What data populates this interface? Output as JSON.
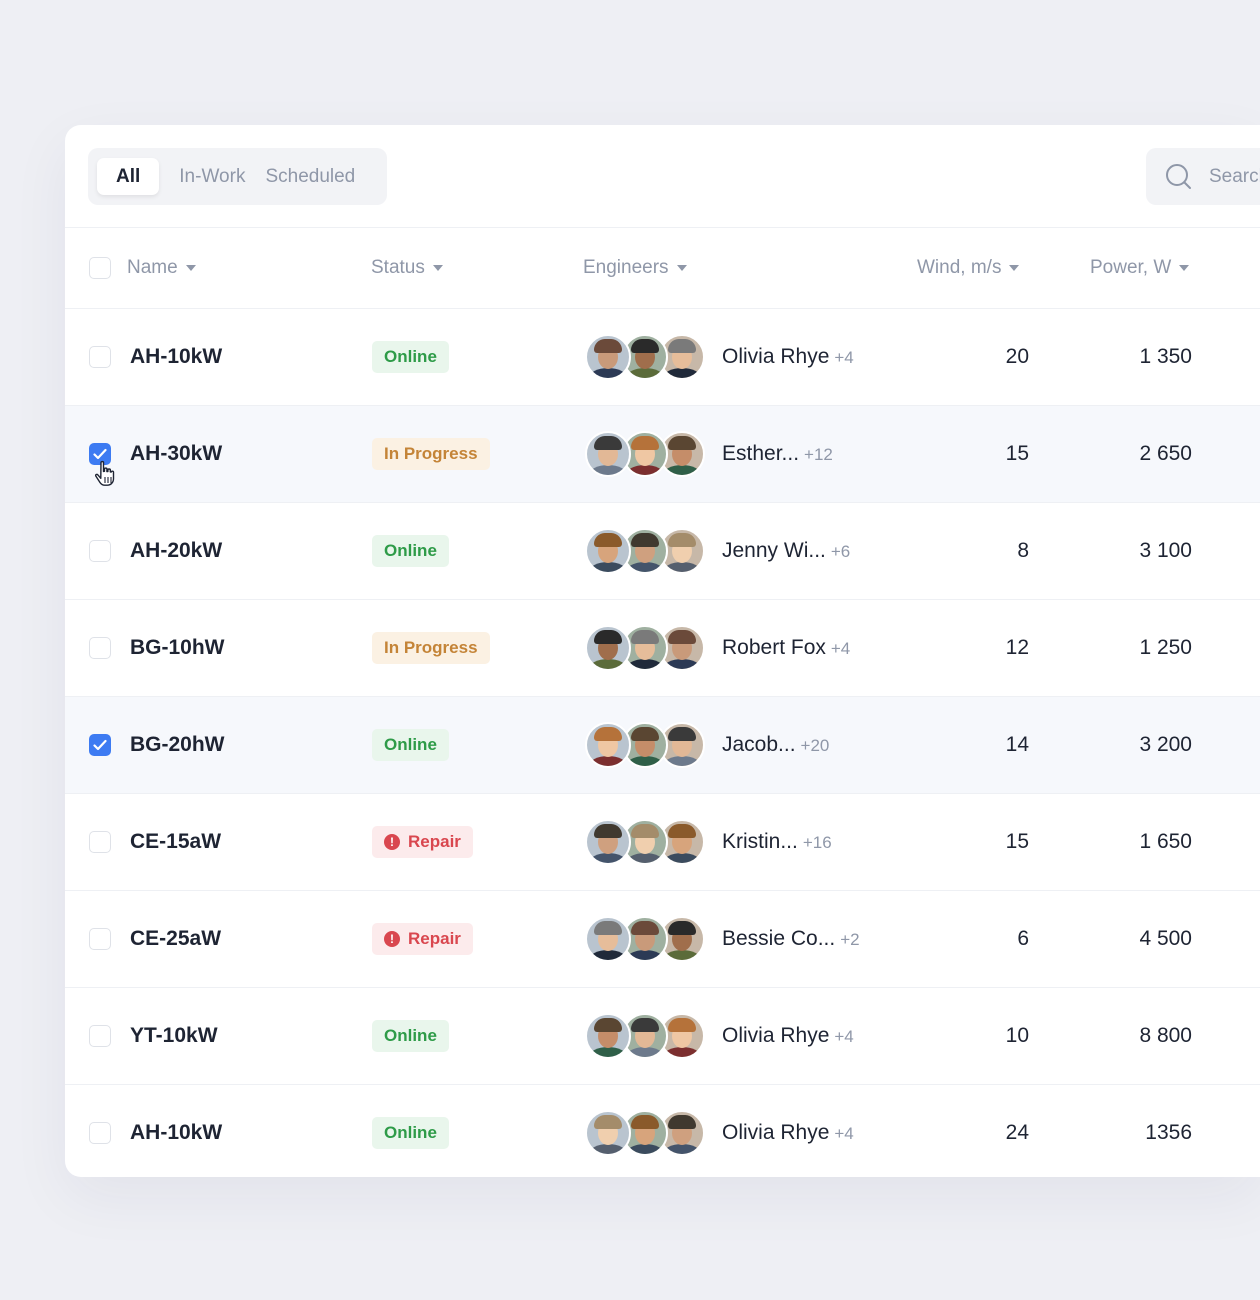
{
  "tabs": [
    {
      "label": "All",
      "active": true
    },
    {
      "label": "In-Work",
      "active": false
    },
    {
      "label": "Scheduled",
      "active": false
    }
  ],
  "search": {
    "placeholder": "Search",
    "icon": "search-icon"
  },
  "columns": {
    "name": "Name",
    "status": "Status",
    "engineers": "Engineers",
    "wind": "Wind, m/s",
    "power": "Power, W"
  },
  "colors": {
    "accent": "#3d7bf2",
    "online": "#2e9b48",
    "in_progress": "#c48437",
    "repair": "#d9474f"
  },
  "rows": [
    {
      "name": "AH-10kW",
      "status": "Online",
      "status_type": "online",
      "engineer": "Olivia Rhye",
      "more": "+4",
      "wind": "20",
      "power": "1 350",
      "checked": false
    },
    {
      "name": "AH-30kW",
      "status": "In Progress",
      "status_type": "progress",
      "engineer": "Esther...",
      "more": "+12",
      "wind": "15",
      "power": "2 650",
      "checked": true
    },
    {
      "name": "AH-20kW",
      "status": "Online",
      "status_type": "online",
      "engineer": "Jenny Wi...",
      "more": "+6",
      "wind": "8",
      "power": "3 100",
      "checked": false
    },
    {
      "name": "BG-10hW",
      "status": "In Progress",
      "status_type": "progress",
      "engineer": "Robert Fox",
      "more": "+4",
      "wind": "12",
      "power": "1 250",
      "checked": false
    },
    {
      "name": "BG-20hW",
      "status": "Online",
      "status_type": "online",
      "engineer": "Jacob...",
      "more": "+20",
      "wind": "14",
      "power": "3 200",
      "checked": true
    },
    {
      "name": "CE-15aW",
      "status": "Repair",
      "status_type": "repair",
      "engineer": "Kristin...",
      "more": "+16",
      "wind": "15",
      "power": "1 650",
      "checked": false
    },
    {
      "name": "CE-25aW",
      "status": "Repair",
      "status_type": "repair",
      "engineer": "Bessie Co...",
      "more": "+2",
      "wind": "6",
      "power": "4 500",
      "checked": false
    },
    {
      "name": "YT-10kW",
      "status": "Online",
      "status_type": "online",
      "engineer": "Olivia Rhye",
      "more": "+4",
      "wind": "10",
      "power": "8 800",
      "checked": false
    },
    {
      "name": "AH-10kW",
      "status": "Online",
      "status_type": "online",
      "engineer": "Olivia Rhye",
      "more": "+4",
      "wind": "24",
      "power": "1356",
      "checked": false
    }
  ]
}
